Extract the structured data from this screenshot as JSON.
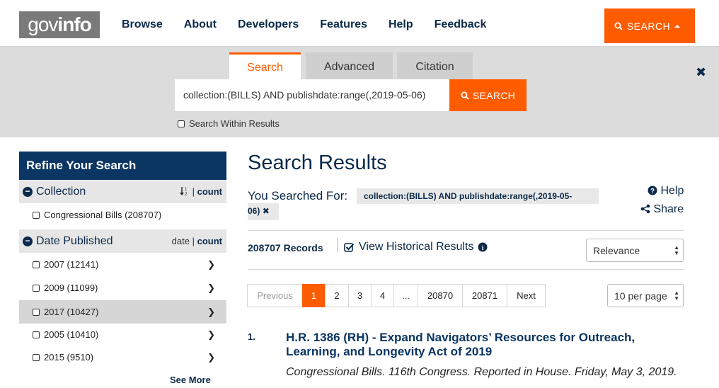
{
  "header": {
    "logo": {
      "light": "gov",
      "bold": "info"
    },
    "nav": [
      "Browse",
      "About",
      "Developers",
      "Features",
      "Help",
      "Feedback"
    ],
    "search_button": "SEARCH",
    "accent_color": "#ff5c00",
    "brand_color": "#0b3563"
  },
  "search_panel": {
    "tabs": [
      "Search",
      "Advanced",
      "Citation"
    ],
    "active_tab": "Search",
    "query": "collection:(BILLS) AND publishdate:range(,2019-05-06)",
    "search_button": "SEARCH",
    "within_results_label": "Search Within Results"
  },
  "refine": {
    "title": "Refine Your Search",
    "collection": {
      "label": "Collection",
      "sort_count": "count",
      "items": [
        {
          "label": "Congressional Bills (208707)"
        }
      ]
    },
    "date_published": {
      "label": "Date Published",
      "sort_date": "date",
      "sort_sep": "|",
      "sort_count": "count",
      "items": [
        {
          "label": "2007 (12141)"
        },
        {
          "label": "2009 (11099)"
        },
        {
          "label": "2017 (10427)"
        },
        {
          "label": "2005 (10410)"
        },
        {
          "label": "2015 (9510)"
        }
      ]
    },
    "see_more": "See More"
  },
  "results": {
    "title": "Search Results",
    "you_searched_label": "You Searched For:",
    "query_line1": "collection:(BILLS) AND publishdate:range(,2019-05-",
    "query_line2": "06)",
    "help": "Help",
    "share": "Share",
    "records": "208707 Records",
    "historical": "View Historical Results",
    "sort_select": "Relevance",
    "per_page_select": "10 per page",
    "pagination": [
      "Previous",
      "1",
      "2",
      "3",
      "4",
      "...",
      "20870",
      "20871",
      "Next"
    ],
    "current_page": "1",
    "items": [
      {
        "num": "1.",
        "title": "H.R. 1386 (RH) - Expand Navigators’ Resources for Outreach, Learning, and Longevity Act of 2019",
        "meta": "Congressional Bills. 116th Congress. Reported in House. Friday, May 3, 2019."
      }
    ]
  }
}
